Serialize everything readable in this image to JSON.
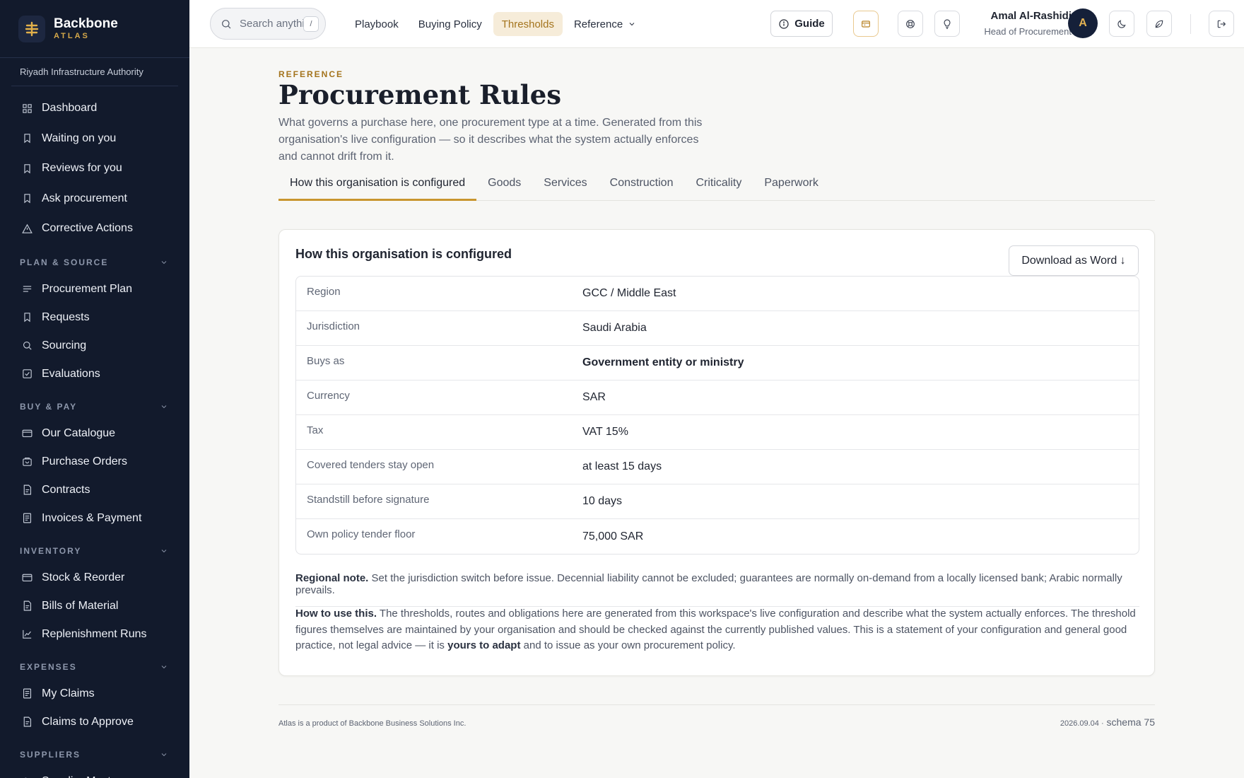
{
  "brand": {
    "name": "Backbone",
    "sub": "ATLAS"
  },
  "organisation": "Riyadh Infrastructure Authority",
  "sidebar": {
    "top_items": [
      {
        "label": "Dashboard",
        "icon": "grid-icon"
      },
      {
        "label": "Waiting on you",
        "icon": "bookmark-icon"
      },
      {
        "label": "Reviews for you",
        "icon": "bookmark-icon"
      },
      {
        "label": "Ask procurement",
        "icon": "bookmark-icon"
      },
      {
        "label": "Corrective Actions",
        "icon": "warning-icon"
      }
    ],
    "sections": [
      {
        "label": "PLAN & SOURCE",
        "items": [
          {
            "label": "Procurement Plan",
            "icon": "list-icon"
          },
          {
            "label": "Requests",
            "icon": "bookmark-icon"
          },
          {
            "label": "Sourcing",
            "icon": "search-icon"
          },
          {
            "label": "Evaluations",
            "icon": "check-square-icon"
          }
        ]
      },
      {
        "label": "BUY & PAY",
        "items": [
          {
            "label": "Our Catalogue",
            "icon": "card-icon"
          },
          {
            "label": "Purchase Orders",
            "icon": "bag-icon"
          },
          {
            "label": "Contracts",
            "icon": "document-icon"
          },
          {
            "label": "Invoices & Payment",
            "icon": "receipt-icon"
          }
        ]
      },
      {
        "label": "INVENTORY",
        "items": [
          {
            "label": "Stock & Reorder",
            "icon": "card-icon"
          },
          {
            "label": "Bills of Material",
            "icon": "document-icon"
          },
          {
            "label": "Replenishment Runs",
            "icon": "chart-icon"
          }
        ]
      },
      {
        "label": "EXPENSES",
        "items": [
          {
            "label": "My Claims",
            "icon": "receipt-icon"
          },
          {
            "label": "Claims to Approve",
            "icon": "document-icon"
          }
        ]
      },
      {
        "label": "SUPPLIERS",
        "items": [
          {
            "label": "Supplier Master",
            "icon": "users-icon"
          }
        ]
      }
    ]
  },
  "topbar": {
    "search_placeholder": "Search anything",
    "search_shortcut": "/",
    "nav": [
      {
        "label": "Playbook",
        "active": false
      },
      {
        "label": "Buying Policy",
        "active": false
      },
      {
        "label": "Thresholds",
        "active": true
      },
      {
        "label": "Reference",
        "active": false,
        "dropdown": true
      }
    ],
    "guide_label": "Guide",
    "user": {
      "name": "Amal Al-Rashidi",
      "role": "Head of Procurement",
      "initial": "A"
    }
  },
  "page": {
    "eyebrow": "REFERENCE",
    "title": "Procurement Rules",
    "intro": "What governs a purchase here, one procurement type at a time. Generated from this organisation's live configuration — so it describes what the system actually enforces and cannot drift from it.",
    "tabs": [
      "How this organisation is configured",
      "Goods",
      "Services",
      "Construction",
      "Criticality",
      "Paperwork"
    ],
    "active_tab": 0
  },
  "card": {
    "title": "How this organisation is configured",
    "download_label": "Download as Word ↓",
    "rows": [
      {
        "key": "Region",
        "value": "GCC / Middle East",
        "bold": false
      },
      {
        "key": "Jurisdiction",
        "value": "Saudi Arabia",
        "bold": false
      },
      {
        "key": "Buys as",
        "value": "Government entity or ministry",
        "bold": true
      },
      {
        "key": "Currency",
        "value": "SAR",
        "bold": false
      },
      {
        "key": "Tax",
        "value": "VAT 15%",
        "bold": false
      },
      {
        "key": "Covered tenders stay open",
        "value": "at least 15 days",
        "bold": false
      },
      {
        "key": "Standstill before signature",
        "value": "10 days",
        "bold": false
      },
      {
        "key": "Own policy tender floor",
        "value": "75,000 SAR",
        "bold": false
      }
    ],
    "regional_note_label": "Regional note.",
    "regional_note": "Set the jurisdiction switch before issue. Decennial liability cannot be excluded; guarantees are normally on-demand from a locally licensed bank; Arabic normally prevails.",
    "how_to_label": "How to use this.",
    "how_to_text": "The thresholds, routes and obligations here are generated from this workspace's live configuration and describe what the system actually enforces. The threshold figures themselves are maintained by your organisation and should be checked against the currently published values. This is a statement of your configuration and general good practice, not legal advice — it is",
    "how_to_bold": "yours to adapt",
    "how_to_end": "and to issue as your own procurement policy."
  },
  "footer": {
    "left": "Atlas is a product of Backbone Business Solutions Inc.",
    "version": "2026.09.04 ·",
    "schema": "schema 75"
  },
  "colors": {
    "sidebar_bg": "#121a2c",
    "accent": "#c9962f",
    "accent_text": "#a4741d"
  }
}
